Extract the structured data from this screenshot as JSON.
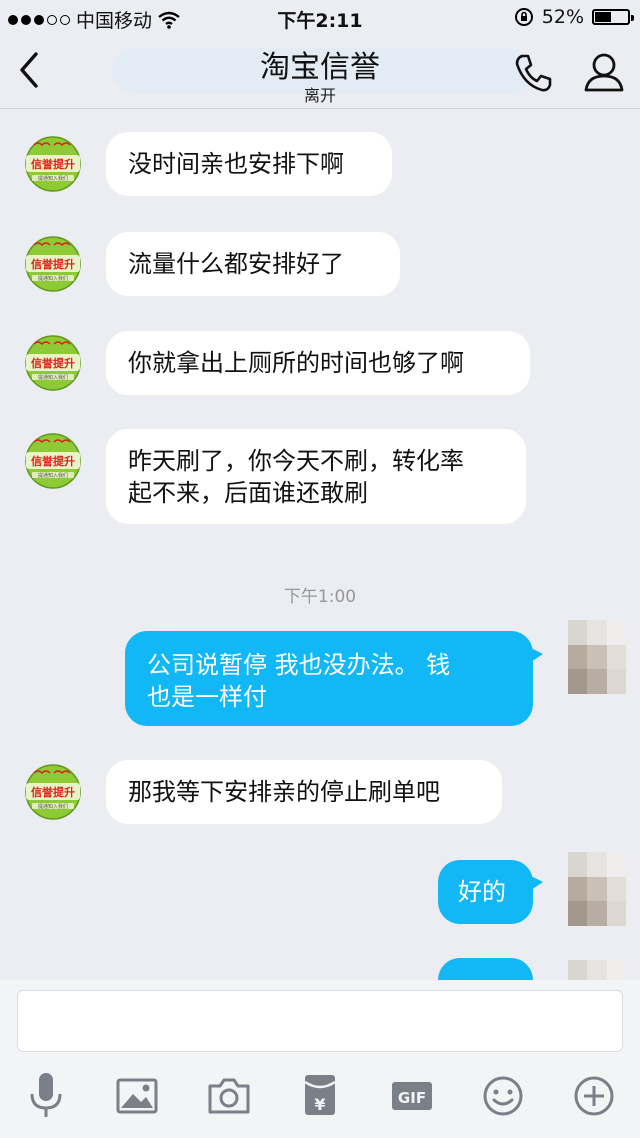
{
  "status_bar": {
    "carrier": "中国移动",
    "time": "下午2:11",
    "battery": "52%",
    "battery_level": 0.52
  },
  "header": {
    "title": "淘宝信誉",
    "subtitle": "离开"
  },
  "avatar_badge": {
    "line1": "信誉提升",
    "line2": "提通知入我们",
    "color": "#7fbf2a"
  },
  "messages": [
    {
      "side": "in",
      "text": "没时间亲也安排下啊"
    },
    {
      "side": "in",
      "text": "流量什么都安排好了"
    },
    {
      "side": "in",
      "text": "你就拿出上厕所的时间也够了啊"
    },
    {
      "side": "in",
      "line1": "昨天刷了，你今天不刷，转化率",
      "line2": "起不来，后面谁还敢刷"
    },
    {
      "side": "out",
      "line1": "公司说暂停  我也没办法。  钱",
      "line2": "也是一样付"
    },
    {
      "side": "in",
      "text": "那我等下安排亲的停止刷单吧"
    },
    {
      "side": "out",
      "text": "好的"
    }
  ],
  "timestamp": "下午1:00",
  "toolbar": {
    "icons": [
      "mic-icon",
      "image-icon",
      "camera-icon",
      "red-packet-icon",
      "gif-icon",
      "emoji-icon",
      "plus-icon"
    ],
    "gif_label": "GIF"
  },
  "colors": {
    "accent": "#12b7f5",
    "background": "#ebedf2"
  }
}
